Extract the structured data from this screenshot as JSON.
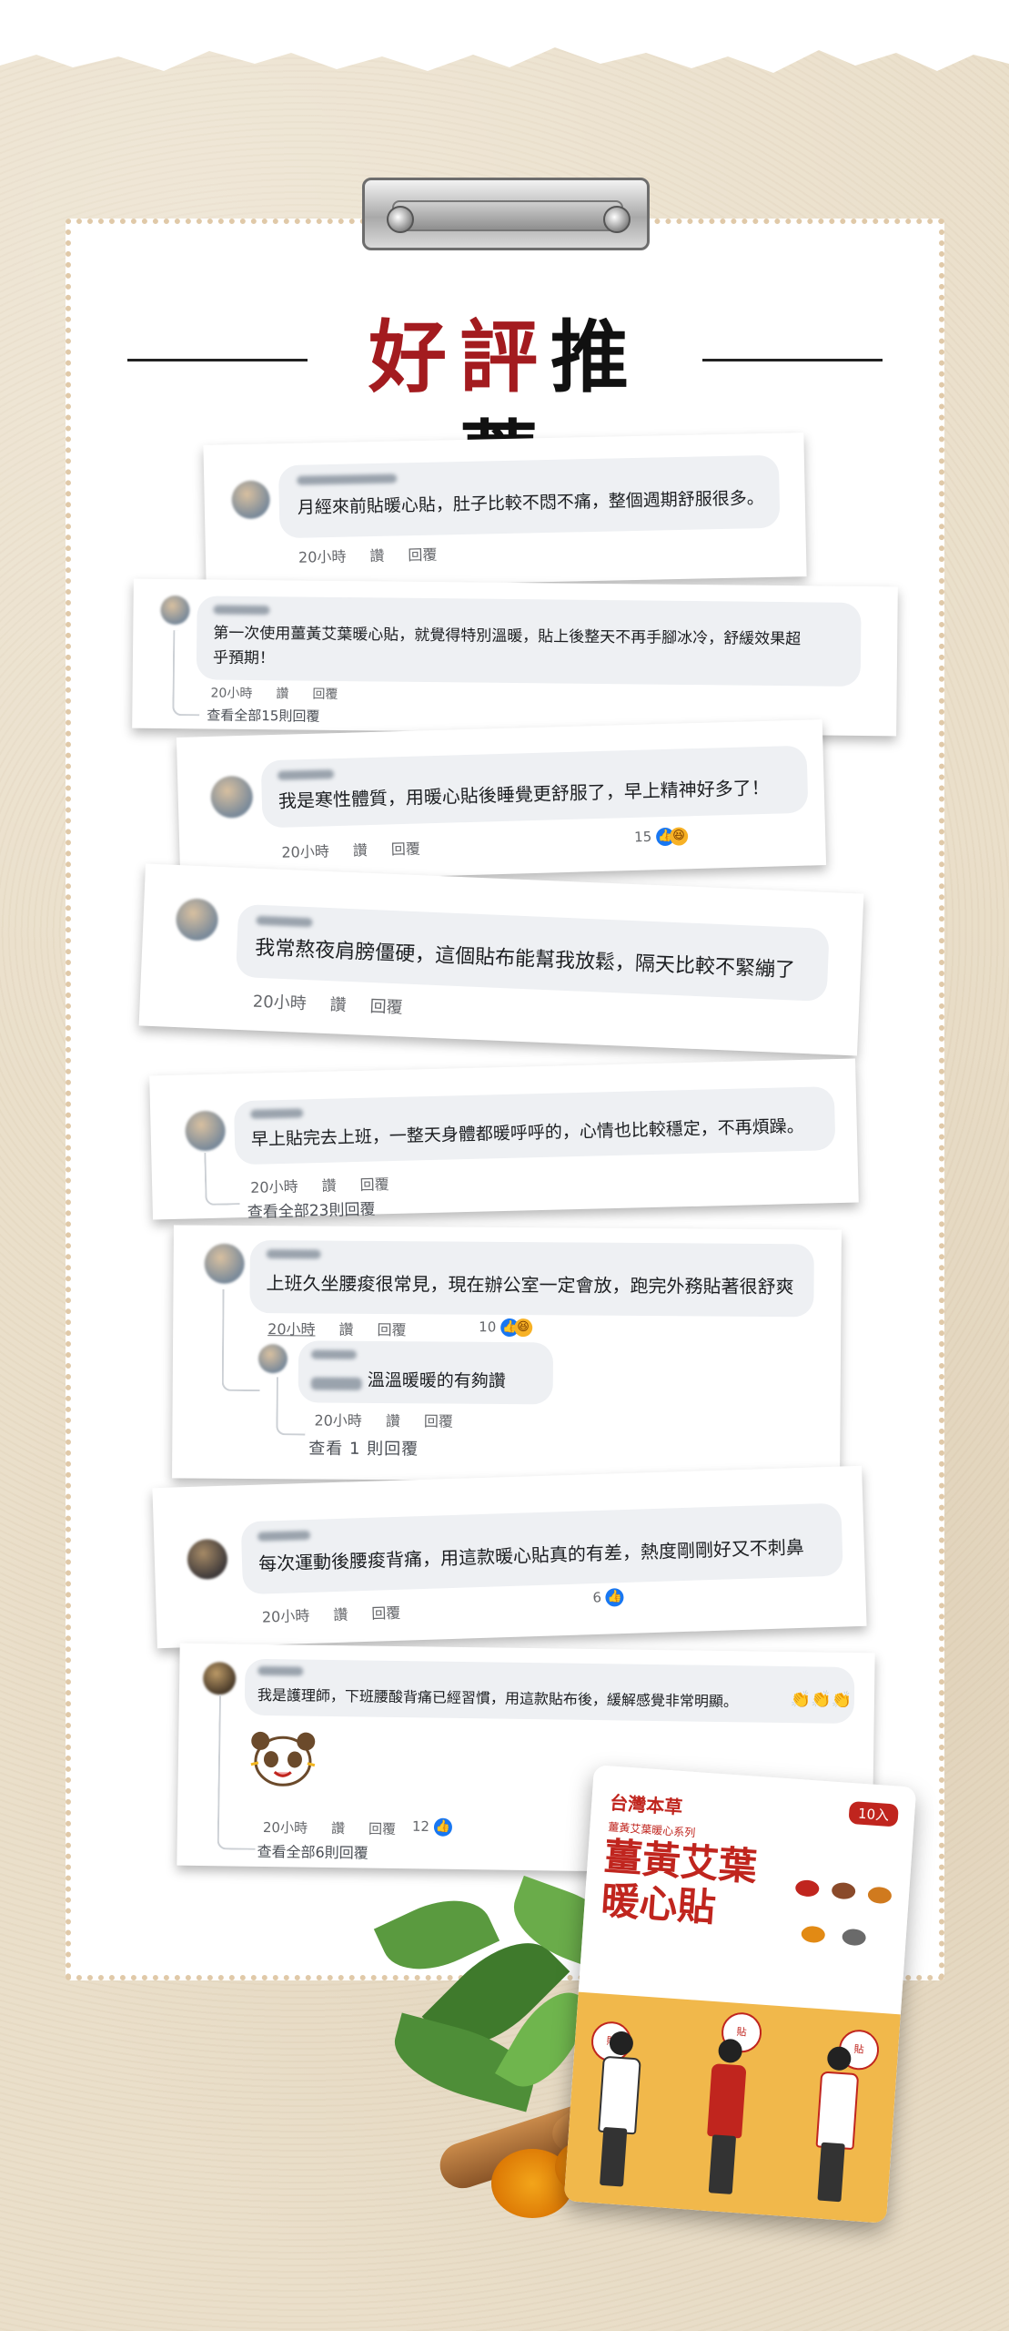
{
  "header": {
    "title_red": "好評",
    "title_black": "推薦"
  },
  "comments": [
    {
      "text": "月經來前貼暖心貼，肚子比較不悶不痛，整個週期舒服很多。",
      "time": "20小時",
      "like": "讚",
      "reply": "回覆"
    },
    {
      "text_line1": "第一次使用薑黃艾葉暖心貼，就覺得特別溫暖，貼上後整天不再手腳冰冷，舒緩效果超",
      "text_line2": "乎預期！",
      "time": "20小時",
      "like": "讚",
      "reply": "回覆",
      "view_replies": "查看全部15則回覆"
    },
    {
      "text": "我是寒性體質，用暖心貼後睡覺更舒服了，早上精神好多了！",
      "time": "20小時",
      "like": "讚",
      "reply": "回覆",
      "reactions": "15"
    },
    {
      "text": "我常熬夜肩膀僵硬，這個貼布能幫我放鬆，隔天比較不緊繃了",
      "time": "20小時",
      "like": "讚",
      "reply": "回覆"
    },
    {
      "text": "早上貼完去上班，一整天身體都暖呼呼的，心情也比較穩定，不再煩躁。",
      "time": "20小時",
      "like": "讚",
      "reply": "回覆",
      "view_replies": "查看全部23則回覆"
    },
    {
      "text": "上班久坐腰痠很常見，現在辦公室一定會放，跑完外務貼著很舒爽",
      "time": "20小時",
      "like": "讚",
      "reply": "回覆",
      "reactions": "10",
      "sub_reply": {
        "text": "溫溫暖暖的有夠讚",
        "time": "20小時",
        "like": "讚",
        "reply": "回覆"
      },
      "view_replies": "查看 1 則回覆"
    },
    {
      "text": "每次運動後腰痠背痛，用這款暖心貼真的有差，熱度剛剛好又不刺鼻",
      "time": "20小時",
      "like": "讚",
      "reply": "回覆",
      "reactions": "6"
    },
    {
      "text": "我是護理師，下班腰酸背痛已經習慣，用這款貼布後，緩解感覺非常明顯。",
      "time": "20小時",
      "like": "讚",
      "reply": "回覆",
      "reactions": "12",
      "view_replies": "查看全部6則回覆"
    }
  ],
  "product": {
    "brand": "台灣本草",
    "series": "薑黃艾葉暖心系列",
    "name_line1": "薑黃艾葉",
    "name_line2": "暖心貼",
    "count_tag": "10入"
  },
  "colors": {
    "accent_red": "#a31b1f",
    "like_blue": "#1877f2",
    "board_dots": "#e0c9a8"
  }
}
